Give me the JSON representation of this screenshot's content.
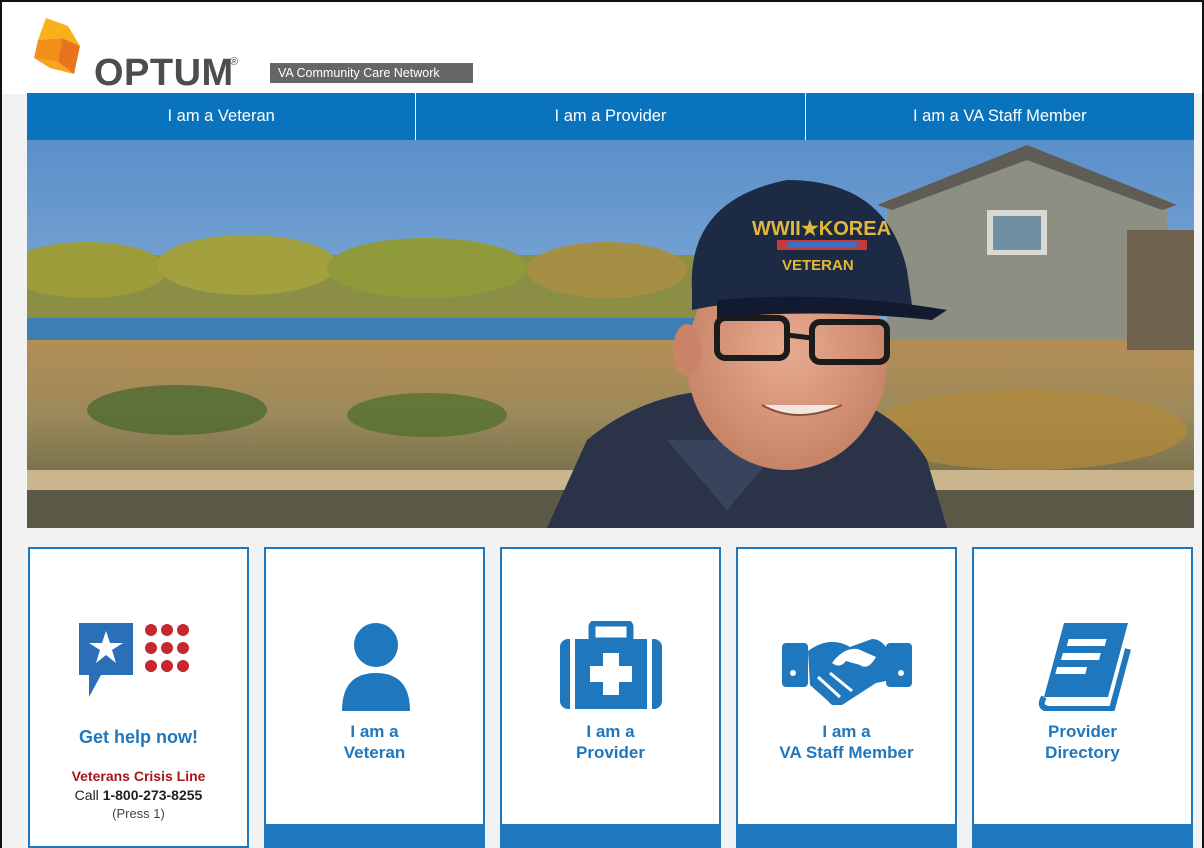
{
  "brand": {
    "logo_text": "OPTUM",
    "logo_reg": "®",
    "network_label": "VA Community Care Network"
  },
  "topnav": [
    {
      "label": "I am a Veteran"
    },
    {
      "label": "I am a Provider"
    },
    {
      "label": "I am a VA Staff Member"
    }
  ],
  "hero": {
    "cap_text_top": "WWII★KOREA",
    "cap_text_bottom": "VETERAN"
  },
  "cards": {
    "crisis": {
      "title": "Get help now!",
      "line_name": "Veterans Crisis Line",
      "call_prefix": "Call",
      "phone": "1-800-273-8255",
      "press": "(Press 1)"
    },
    "veteran": {
      "line1": "I am a",
      "line2": "Veteran"
    },
    "provider": {
      "line1": "I am a",
      "line2": "Provider"
    },
    "staff": {
      "line1": "I am a",
      "line2": "VA Staff Member"
    },
    "directory": {
      "line1": "Provider",
      "line2": "Directory"
    }
  },
  "colors": {
    "nav_blue": "#0a73bd",
    "card_blue": "#1f77bd",
    "crisis_red": "#a8161e",
    "logo_orange": "#f5a01a",
    "network_gray": "#666666"
  },
  "icons": [
    "optum-logo-icon",
    "crisis-chat-icon",
    "person-icon",
    "medical-kit-icon",
    "handshake-icon",
    "book-icon"
  ]
}
